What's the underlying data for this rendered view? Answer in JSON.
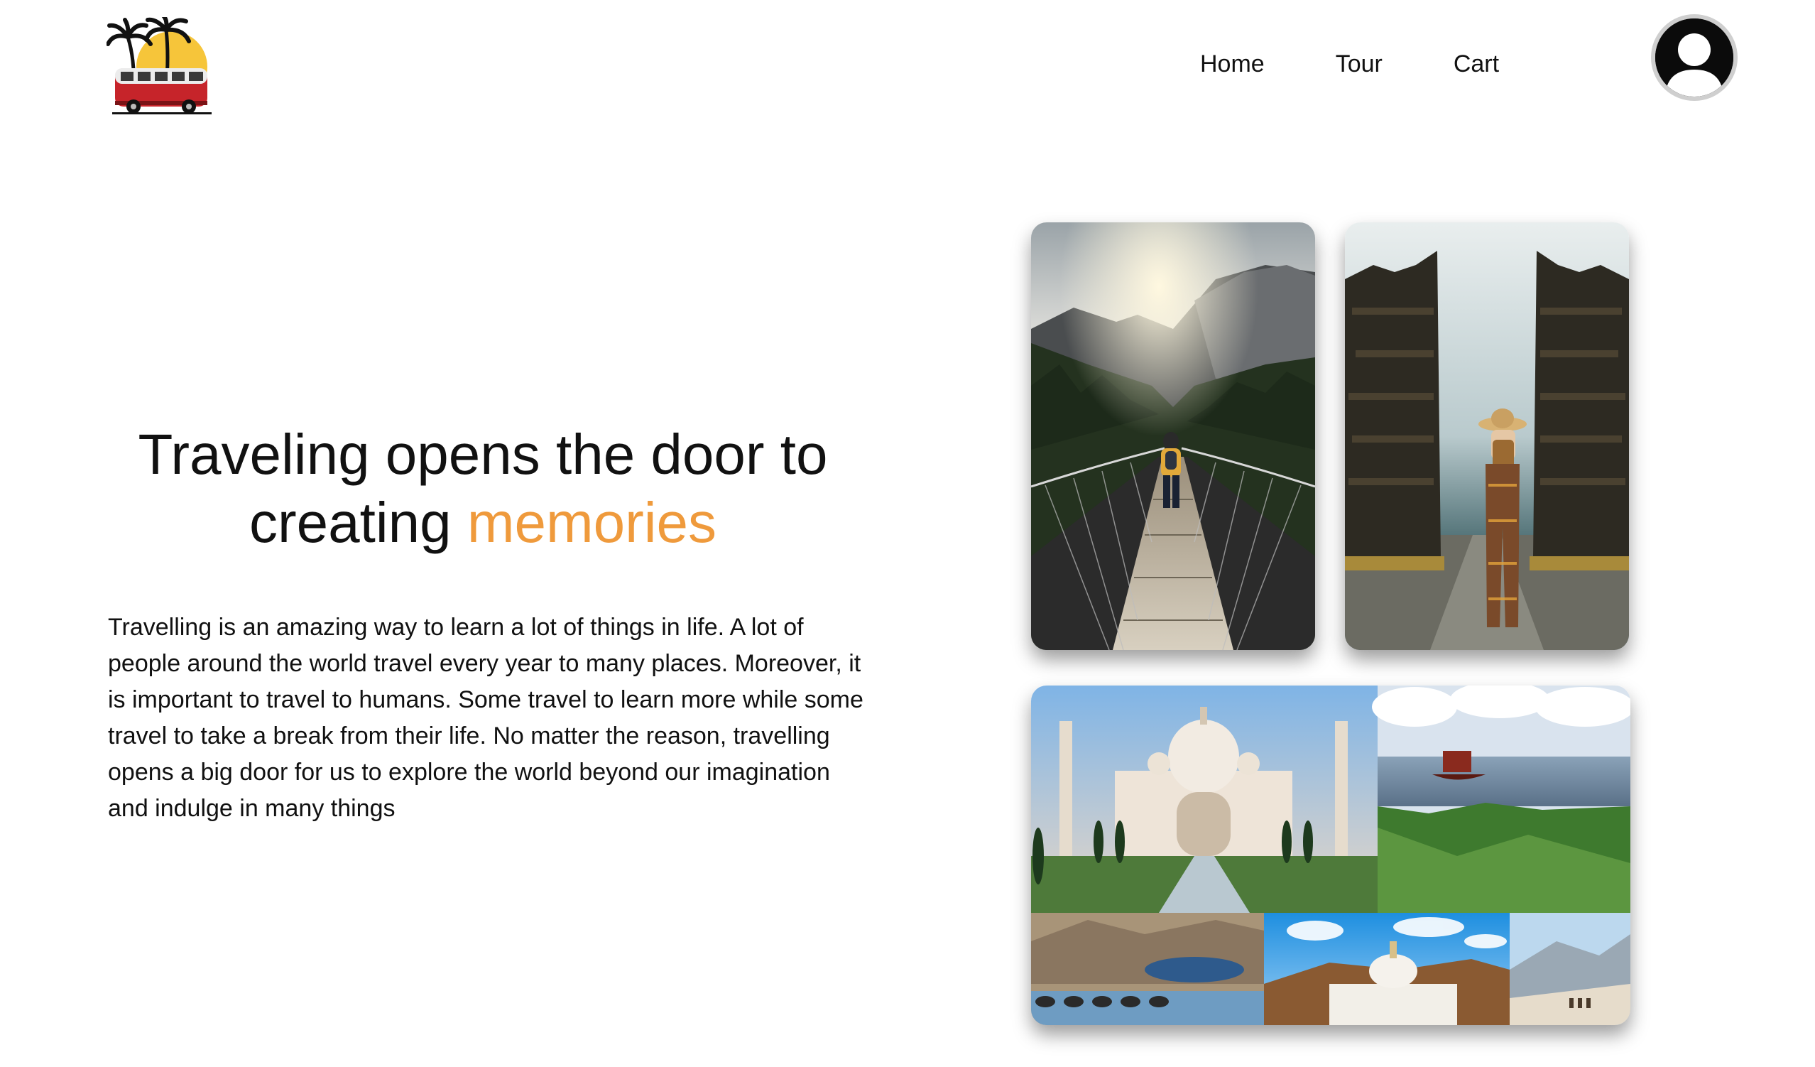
{
  "header": {
    "logo_icon": "travel-van-palm-sunset-logo",
    "nav": [
      {
        "label": "Home"
      },
      {
        "label": "Tour"
      },
      {
        "label": "Cart"
      }
    ],
    "avatar_icon": "user-avatar-icon"
  },
  "hero": {
    "title_line1": "Traveling opens the door to",
    "title_line2_prefix": "creating ",
    "title_accent": "memories",
    "accent_color": "#ef9a3c",
    "body": "Travelling is an amazing way to learn a lot of things in life. A lot of people around the world travel every year to many places. Moreover, it is important to travel to humans. Some travel to learn more while some travel to take a break from their life. No matter the reason, travelling opens a big door for us to explore the world beyond our imagination and indulge in many things"
  },
  "gallery": {
    "photos": [
      {
        "name": "suspension-bridge-photo"
      },
      {
        "name": "bali-temple-gate-photo"
      },
      {
        "name": "india-landmarks-collage-photo"
      }
    ]
  }
}
